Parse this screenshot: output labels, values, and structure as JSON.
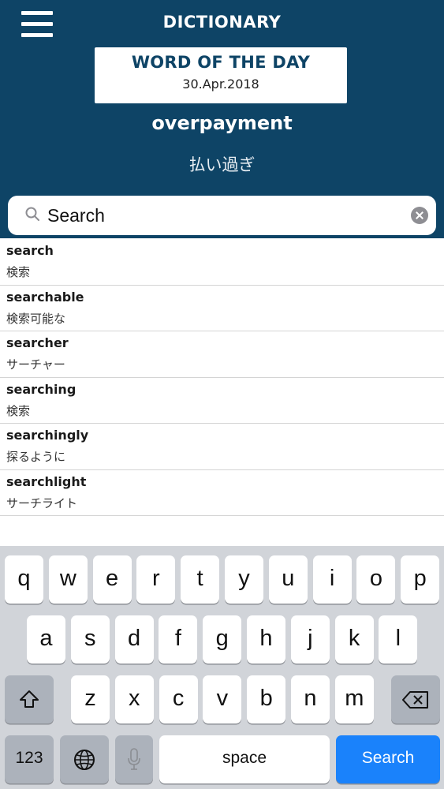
{
  "header": {
    "title": "DICTIONARY",
    "menu_icon": "hamburger-menu-icon"
  },
  "word_of_the_day": {
    "label": "WORD OF THE DAY",
    "date": "30.Apr.2018",
    "word": "overpayment",
    "translation": "払い過ぎ"
  },
  "search": {
    "placeholder": "Search",
    "value": "",
    "search_icon": "magnifier-icon",
    "clear_icon": "clear-icon"
  },
  "results": [
    {
      "word": "search",
      "translation": "検索"
    },
    {
      "word": "searchable",
      "translation": "検索可能な"
    },
    {
      "word": "searcher",
      "translation": "サーチャー"
    },
    {
      "word": "searching",
      "translation": "検索"
    },
    {
      "word": "searchingly",
      "translation": "探るように"
    },
    {
      "word": "searchlight",
      "translation": "サーチライト"
    }
  ],
  "keyboard": {
    "row1": [
      "q",
      "w",
      "e",
      "r",
      "t",
      "y",
      "u",
      "i",
      "o",
      "p"
    ],
    "row2": [
      "a",
      "s",
      "d",
      "f",
      "g",
      "h",
      "j",
      "k",
      "l"
    ],
    "row3": [
      "z",
      "x",
      "c",
      "v",
      "b",
      "n",
      "m"
    ],
    "numbers_label": "123",
    "space_label": "space",
    "search_label": "Search",
    "colors": {
      "background": "#d1d4d9",
      "key": "#ffffff",
      "special_key": "#acb2bb",
      "action_key": "#1a82fb"
    }
  },
  "theme": {
    "header_color": "#0e4466"
  }
}
